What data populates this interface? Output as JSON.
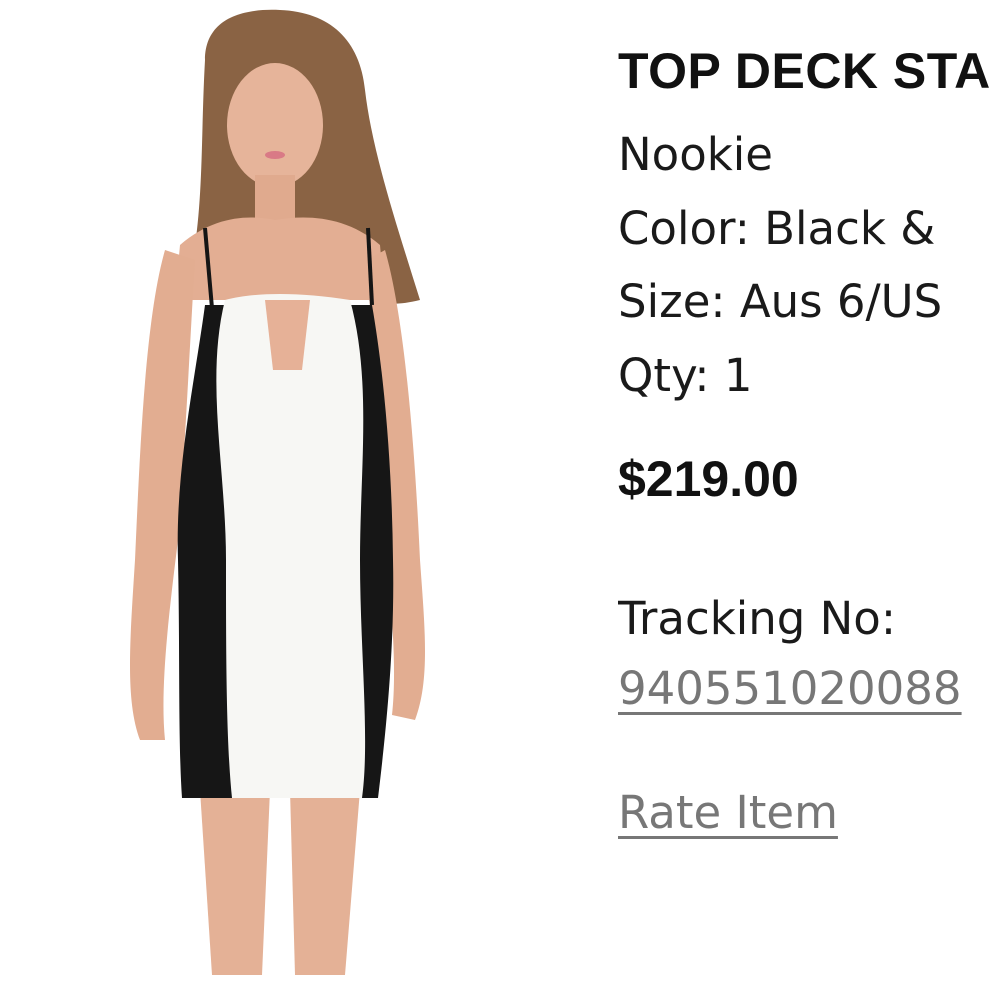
{
  "product": {
    "brand": "TOP DECK STA",
    "name": "Nookie",
    "color_line": "Color: Black &",
    "size_line": "Size: Aus 6/US",
    "qty_line": "Qty: 1",
    "price": "$219.00"
  },
  "shipping": {
    "tracking_label": "Tracking No:",
    "tracking_number": "940551020088"
  },
  "actions": {
    "rate_item_label": "Rate Item"
  },
  "colors": {
    "text": "#111111",
    "link": "#777777",
    "background": "#ffffff"
  }
}
